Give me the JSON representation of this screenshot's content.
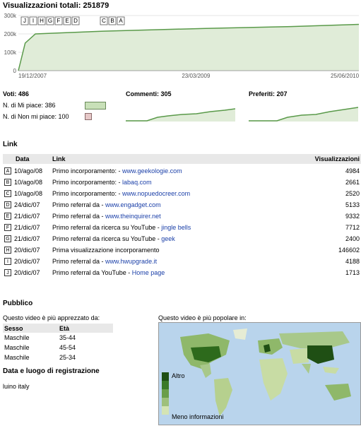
{
  "header": {
    "title": "Visualizzazioni totali: 251879"
  },
  "chart_data": {
    "type": "area",
    "x": [
      "19/12/2007",
      "23/03/2009",
      "25/06/2010"
    ],
    "y_ticks": [
      "300k",
      "200k",
      "100k",
      "0"
    ],
    "ylim": [
      0,
      300000
    ],
    "series": [
      {
        "values": [
          0,
          150000,
          200000,
          215000,
          230000,
          240000,
          251879
        ]
      }
    ],
    "markers": [
      "J",
      "I",
      "H",
      "G",
      "F",
      "E",
      "D",
      "C",
      "B",
      "A"
    ],
    "colors": {
      "fill": "#e0ecd8",
      "line": "#5a9a4a"
    }
  },
  "stats": {
    "votes_label": "Voti: 486",
    "likes_label": "N. di Mi piace: 386",
    "dislikes_label": "N. di Non mi piace: 100",
    "comments_label": "Commenti: 305",
    "favorites_label": "Preferiti: 207"
  },
  "links": {
    "section_title": "Link",
    "headers": {
      "date": "Data",
      "link": "Link",
      "views": "Visualizzazioni"
    },
    "rows": [
      {
        "marker": "A",
        "date": "10/ago/08",
        "text": "Primo incorporamento: - ",
        "url": "www.geekologie.com",
        "views": "4984"
      },
      {
        "marker": "B",
        "date": "10/ago/08",
        "text": "Primo incorporamento: - ",
        "url": "labaq.com",
        "views": "2661"
      },
      {
        "marker": "C",
        "date": "10/ago/08",
        "text": "Primo incorporamento: - ",
        "url": "www.nopuedocreer.com",
        "views": "2520"
      },
      {
        "marker": "D",
        "date": "24/dic/07",
        "text": "Primo referral da - ",
        "url": "www.engadget.com",
        "views": "5133"
      },
      {
        "marker": "E",
        "date": "21/dic/07",
        "text": "Primo referral da - ",
        "url": "www.theinquirer.net",
        "views": "9332"
      },
      {
        "marker": "F",
        "date": "21/dic/07",
        "text": "Primo referral da ricerca su YouTube - ",
        "url": "jingle bells",
        "views": "7712"
      },
      {
        "marker": "G",
        "date": "21/dic/07",
        "text": "Primo referral da ricerca su YouTube - ",
        "url": "geek",
        "views": "2400"
      },
      {
        "marker": "H",
        "date": "20/dic/07",
        "text": "Prima visualizzazione incorporamento",
        "url": "",
        "views": "146602"
      },
      {
        "marker": "I",
        "date": "20/dic/07",
        "text": "Primo referral da - ",
        "url": "www.hwupgrade.it",
        "views": "4188"
      },
      {
        "marker": "J",
        "date": "20/dic/07",
        "text": "Primo referral da YouTube - ",
        "url": "Home page",
        "views": "1713"
      }
    ]
  },
  "audience": {
    "section_title": "Pubblico",
    "liked_by": "Questo video è più apprezzato da:",
    "headers": {
      "sex": "Sesso",
      "age": "Età"
    },
    "rows": [
      {
        "sex": "Maschile",
        "age": "35-44"
      },
      {
        "sex": "Maschile",
        "age": "45-54"
      },
      {
        "sex": "Maschile",
        "age": "25-34"
      }
    ],
    "popular_in": "Questo video è più popolare in:",
    "legend_high": "Altro",
    "legend_low": "Meno informazioni"
  },
  "recording": {
    "title": "Data e luogo di registrazione",
    "value": "luino italy"
  }
}
